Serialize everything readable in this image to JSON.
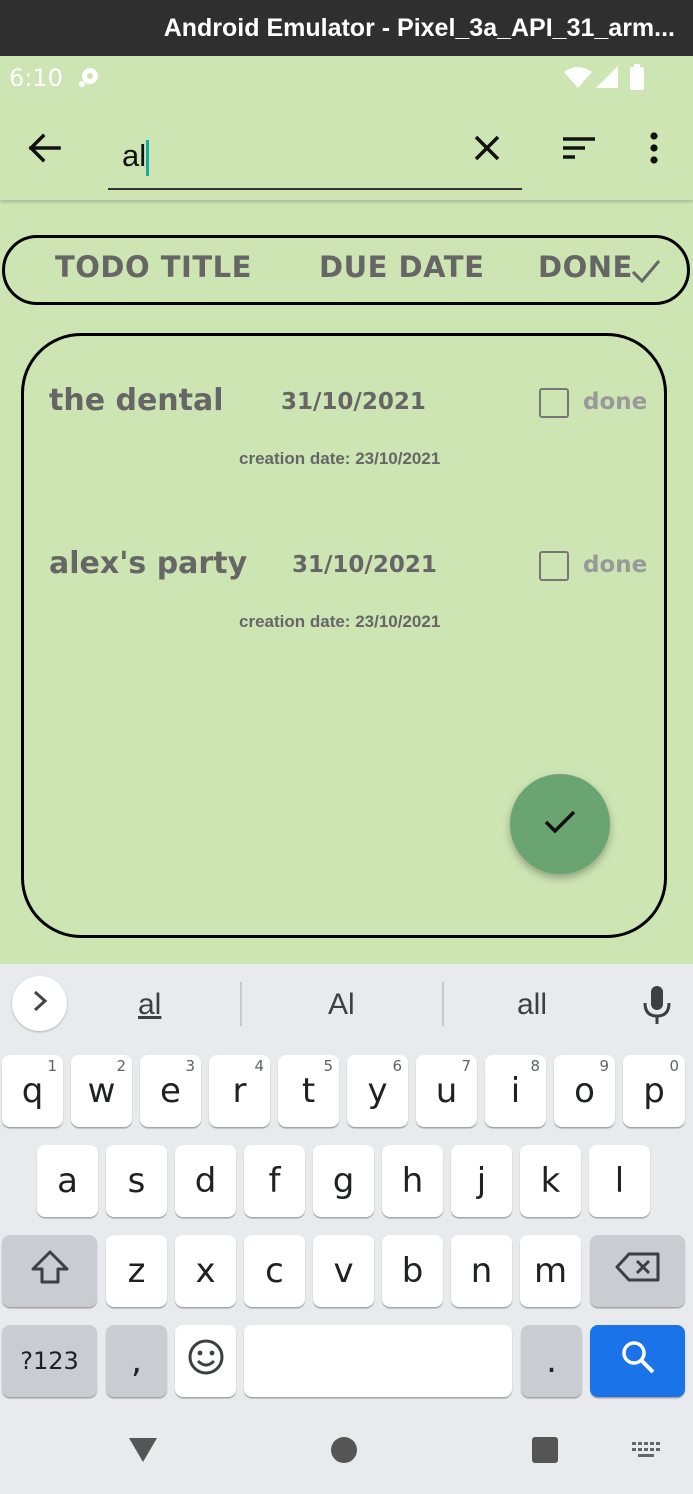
{
  "window": {
    "title": "Android Emulator - Pixel_3a_API_31_arm..."
  },
  "status_bar": {
    "time": "6:10",
    "icons": [
      "notification-icon",
      "wifi-icon",
      "signal-icon",
      "battery-icon"
    ]
  },
  "app_bar": {
    "back_icon": "arrow-back-icon",
    "search_value": "al",
    "clear_icon": "close-icon",
    "sort_icon": "sort-icon",
    "menu_icon": "more-vert-icon"
  },
  "header": {
    "col_title": "TODO TITLE",
    "col_due": "DUE DATE",
    "col_done": "DONE"
  },
  "todos": [
    {
      "title": "the dental",
      "due": "31/10/2021",
      "done": false,
      "done_label": "done",
      "created": "creation date: 23/10/2021"
    },
    {
      "title": "alex's party",
      "due": "31/10/2021",
      "done": false,
      "done_label": "done",
      "created": "creation date: 23/10/2021"
    }
  ],
  "fab": {
    "icon": "check-icon"
  },
  "keyboard": {
    "suggestions": [
      "al",
      "Al",
      "all"
    ],
    "row1": [
      {
        "k": "q",
        "h": "1"
      },
      {
        "k": "w",
        "h": "2"
      },
      {
        "k": "e",
        "h": "3"
      },
      {
        "k": "r",
        "h": "4"
      },
      {
        "k": "t",
        "h": "5"
      },
      {
        "k": "y",
        "h": "6"
      },
      {
        "k": "u",
        "h": "7"
      },
      {
        "k": "i",
        "h": "8"
      },
      {
        "k": "o",
        "h": "9"
      },
      {
        "k": "p",
        "h": "0"
      }
    ],
    "row2": [
      "a",
      "s",
      "d",
      "f",
      "g",
      "h",
      "j",
      "k",
      "l"
    ],
    "row3": [
      "z",
      "x",
      "c",
      "v",
      "b",
      "n",
      "m"
    ],
    "symbols": "?123",
    "comma": ",",
    "period": "."
  },
  "colors": {
    "app_bg": "#cde4b3",
    "fab": "#6aa571",
    "search_key": "#1a73e8",
    "accent_caret": "#1fa7a0"
  }
}
